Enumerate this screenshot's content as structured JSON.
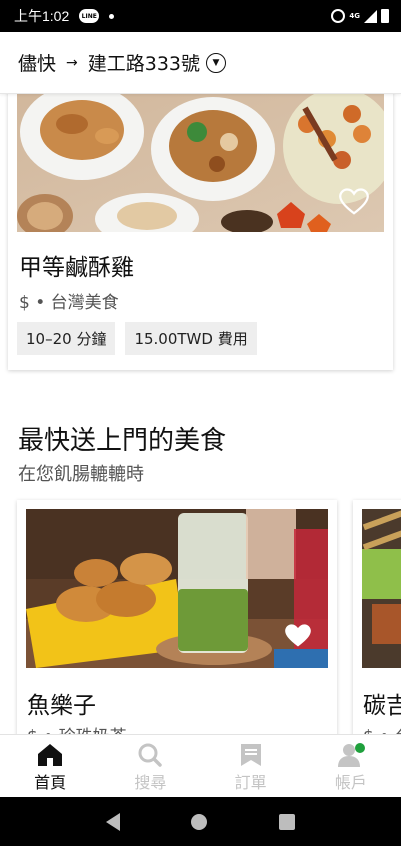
{
  "status_bar": {
    "time": "上午1:02",
    "network": "4G"
  },
  "header": {
    "when": "儘快",
    "arrow": "→",
    "address": "建工路333號"
  },
  "featured_store": {
    "name": "甲等鹹酥雞",
    "meta": "$ • 台灣美食",
    "chips": [
      "10–20 分鐘",
      "15.00TWD 費用"
    ]
  },
  "section": {
    "title": "最快送上門的美食",
    "subtitle": "在您飢腸轆轆時"
  },
  "carousel": [
    {
      "name": "魚樂子",
      "meta": "$ • 珍珠奶茶"
    },
    {
      "name": "碳吉",
      "meta": "$ • 台"
    }
  ],
  "bottom_nav": [
    {
      "label": "首頁",
      "icon": "home-icon",
      "active": true
    },
    {
      "label": "搜尋",
      "icon": "search-icon",
      "active": false
    },
    {
      "label": "訂單",
      "icon": "orders-icon",
      "active": false
    },
    {
      "label": "帳戶",
      "icon": "account-icon",
      "active": false
    }
  ],
  "colors": {
    "accent_green": "#1fa03c",
    "text_primary": "#111111",
    "text_secondary": "#545454",
    "nav_inactive": "#c4c4c4"
  }
}
